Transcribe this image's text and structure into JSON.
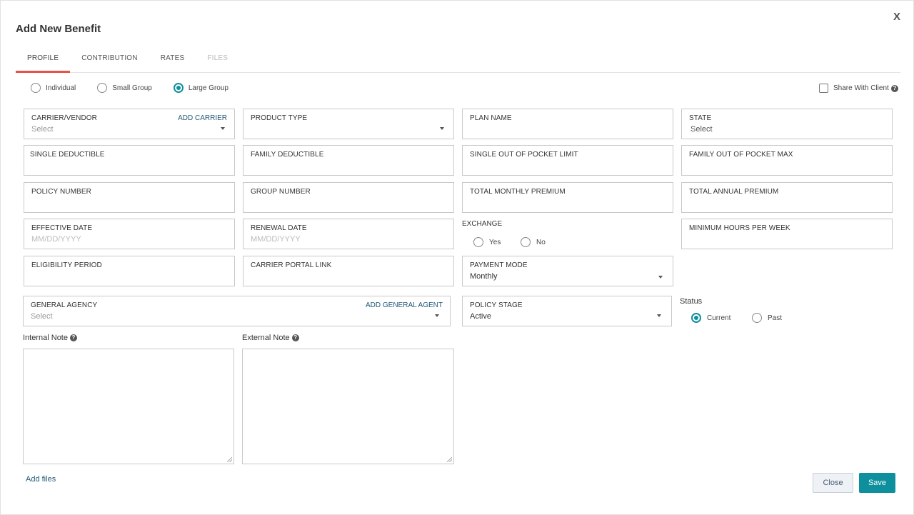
{
  "dialog": {
    "title": "Add New Benefit",
    "close_glyph": "X"
  },
  "tabs": [
    {
      "label": "PROFILE",
      "state": "active"
    },
    {
      "label": "CONTRIBUTION",
      "state": "normal"
    },
    {
      "label": "RATES",
      "state": "normal"
    },
    {
      "label": "FILES",
      "state": "disabled"
    }
  ],
  "group_type": {
    "options": [
      "Individual",
      "Small Group",
      "Large Group"
    ],
    "selected": "Large Group"
  },
  "share_with_client": {
    "label": "Share With Client",
    "checked": false,
    "help": "?"
  },
  "fields": {
    "carrier_vendor": {
      "label": "CARRIER/VENDOR",
      "placeholder": "Select",
      "link": "ADD CARRIER"
    },
    "product_type": {
      "label": "PRODUCT TYPE",
      "value": ""
    },
    "plan_name": {
      "label": "PLAN NAME",
      "value": ""
    },
    "state": {
      "label": "STATE",
      "placeholder": "Select"
    },
    "single_deductible": {
      "label": "SINGLE DEDUCTIBLE",
      "value": ""
    },
    "family_deductible": {
      "label": "FAMILY DEDUCTIBLE",
      "value": ""
    },
    "single_oop_limit": {
      "label": "SINGLE OUT OF POCKET LIMIT",
      "value": ""
    },
    "family_oop_max": {
      "label": "FAMILY OUT OF POCKET MAX",
      "value": ""
    },
    "policy_number": {
      "label": "POLICY NUMBER",
      "value": ""
    },
    "group_number": {
      "label": "GROUP NUMBER",
      "value": ""
    },
    "total_monthly_premium": {
      "label": "TOTAL MONTHLY PREMIUM",
      "value": ""
    },
    "total_annual_premium": {
      "label": "TOTAL ANNUAL PREMIUM",
      "value": ""
    },
    "effective_date": {
      "label": "EFFECTIVE DATE",
      "placeholder": "MM/DD/YYYY"
    },
    "renewal_date": {
      "label": "RENEWAL DATE",
      "placeholder": "MM/DD/YYYY"
    },
    "minimum_hours": {
      "label": "MINIMUM HOURS PER WEEK",
      "value": ""
    },
    "eligibility_period": {
      "label": "ELIGIBILITY PERIOD",
      "value": ""
    },
    "carrier_portal_link": {
      "label": "CARRIER PORTAL LINK",
      "value": ""
    },
    "payment_mode": {
      "label": "PAYMENT MODE",
      "value": "Monthly"
    },
    "general_agency": {
      "label": "GENERAL AGENCY",
      "placeholder": "Select",
      "link": "ADD GENERAL AGENT"
    },
    "policy_stage": {
      "label": "POLICY STAGE",
      "value": "Active"
    }
  },
  "exchange": {
    "label": "EXCHANGE",
    "options": [
      "Yes",
      "No"
    ],
    "selected": null
  },
  "status": {
    "label": "Status",
    "options": [
      "Current",
      "Past"
    ],
    "selected": "Current"
  },
  "notes": {
    "internal_label": "Internal Note",
    "external_label": "External Note",
    "help": "?"
  },
  "footer": {
    "add_files": "Add files",
    "close_label": "Close",
    "save_label": "Save"
  },
  "colors": {
    "accent": "#0e8f9d",
    "active_tab_underline": "#e5534b",
    "link": "#245a7a"
  }
}
